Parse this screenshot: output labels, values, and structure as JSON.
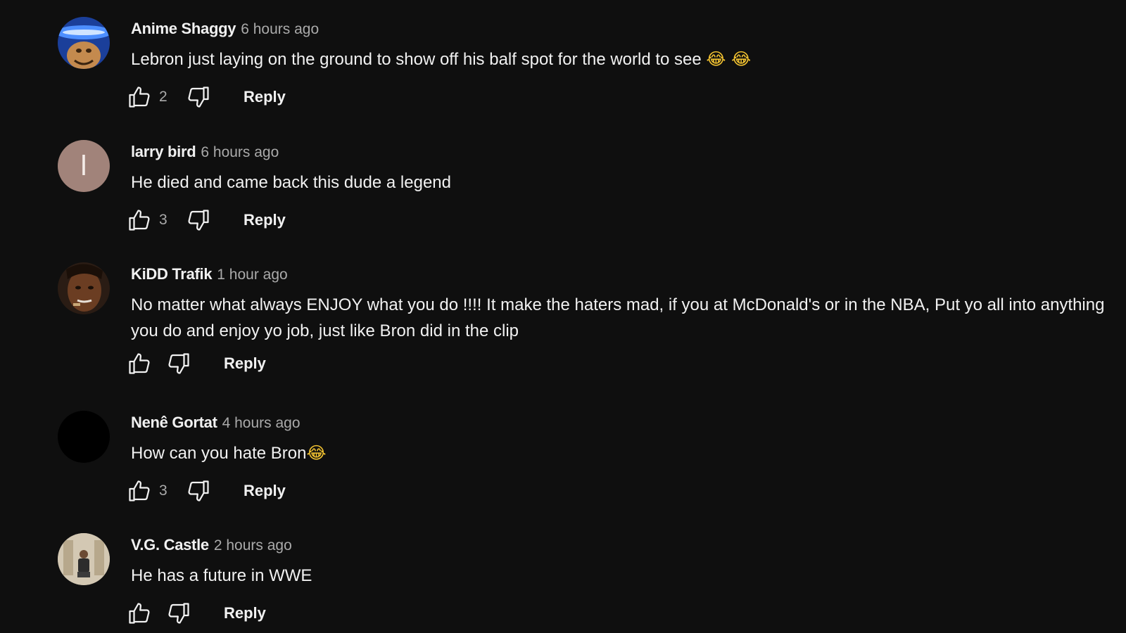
{
  "comments": [
    {
      "author": "Anime Shaggy",
      "time": "6 hours ago",
      "text": "Lebron just laying on the ground to show off his balf spot for the world to see",
      "emoji": "😂 😂",
      "likes": "2",
      "reply_label": "Reply",
      "avatar": "cartoon-shaggy-avatar"
    },
    {
      "author": "larry bird",
      "time": "6 hours ago",
      "text": "He died and came back this dude a legend",
      "emoji": "",
      "likes": "3",
      "reply_label": "Reply",
      "avatar_letter": "l",
      "avatar_color": "#a1837a"
    },
    {
      "author": "KiDD Trafik",
      "time": "1 hour ago",
      "text": "No matter what always ENJOY what you do !!!! It make the haters mad, if you at McDonald's or in the NBA, Put yo all into anything you do and enjoy yo job, just like Bron did in the clip",
      "emoji": "",
      "likes": "",
      "reply_label": "Reply",
      "avatar": "person-photo-avatar"
    },
    {
      "author": "Nenê Gortat",
      "time": "4 hours ago",
      "text": "How can you hate Bron",
      "emoji": "😂",
      "likes": "3",
      "reply_label": "Reply",
      "avatar": "black-avatar"
    },
    {
      "author": "V.G. Castle",
      "time": "2 hours ago",
      "text": "He has a future in WWE",
      "emoji": "",
      "likes": "",
      "reply_label": "Reply",
      "avatar": "person-photo-avatar"
    }
  ],
  "icons": {
    "like": "thumbs-up-icon",
    "dislike": "thumbs-down-icon"
  },
  "colors": {
    "background": "#0f0f0f",
    "text": "#f1f1f1",
    "secondary_text": "#aaaaaa",
    "emoji": "#f2c230"
  }
}
